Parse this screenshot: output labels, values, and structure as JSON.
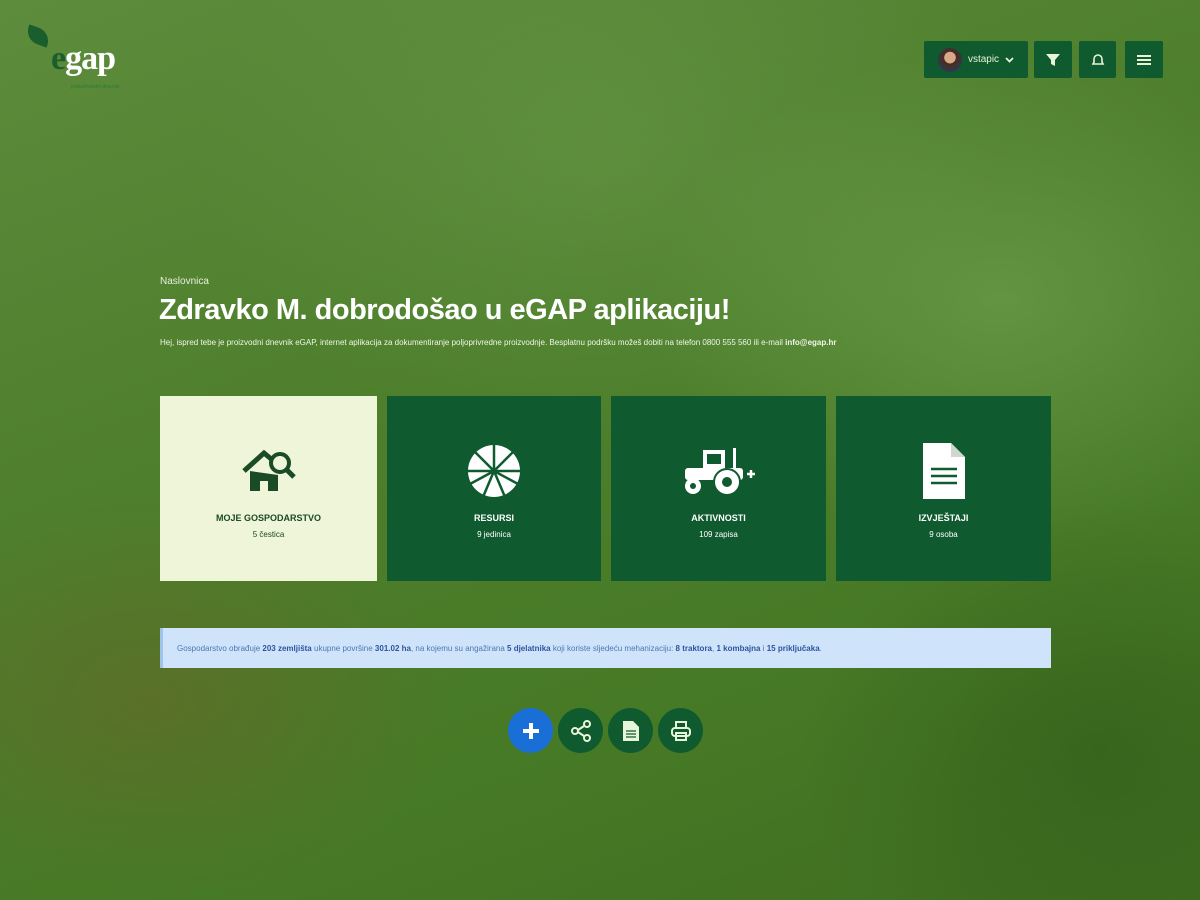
{
  "logo": {
    "text": "egap",
    "tagline": "poljoprivredni dnevnik"
  },
  "header": {
    "username": "vstapic",
    "filter_icon": "filter-icon",
    "bell_icon": "bell-icon",
    "menu_icon": "menu-icon"
  },
  "breadcrumb": "Naslovnica",
  "title": "Zdravko M. dobrodošao u eGAP aplikaciju!",
  "intro": {
    "text": "Hej, ispred tebe je proizvodni dnevnik eGAP, internet aplikacija za dokumentiranje poljoprivredne proizvodnje. Besplatnu podršku možeš dobiti na telefon 0800 555 560 ili e-mail ",
    "email": "info@egap.hr"
  },
  "cards": [
    {
      "title": "Moje gospodarstvo",
      "subtitle": "5 čestica",
      "icon": "house-search-icon"
    },
    {
      "title": "Resursi",
      "subtitle": "9 jedinica",
      "icon": "field-sun-icon"
    },
    {
      "title": "Aktivnosti",
      "subtitle": "109 zapisa",
      "icon": "tractor-icon"
    },
    {
      "title": "Izvještaji",
      "subtitle": "9 osoba",
      "icon": "document-icon"
    }
  ],
  "info": {
    "p1": "Gospodarstvo obrađuje ",
    "parcels": "203 zemljišta",
    "p2": " ukupne površine ",
    "area": "301.02 ha",
    "p3": ", na kojemu su angažirana ",
    "workers": "5 djelatnika",
    "p4": " koji koriste sljedeću mehanizaciju: ",
    "tractors": "8 traktora",
    "p5": ", ",
    "combines": "1 kombajna",
    "p6": " i ",
    "implements": "15 priključaka",
    "p7": "."
  },
  "actions": [
    "add-icon",
    "share-icon",
    "document-icon",
    "print-icon"
  ],
  "colors": {
    "primary": "#0f5a2e",
    "active_card": "#eef5d8",
    "info_bg": "#cfe4fb",
    "add": "#1a6fd6"
  }
}
